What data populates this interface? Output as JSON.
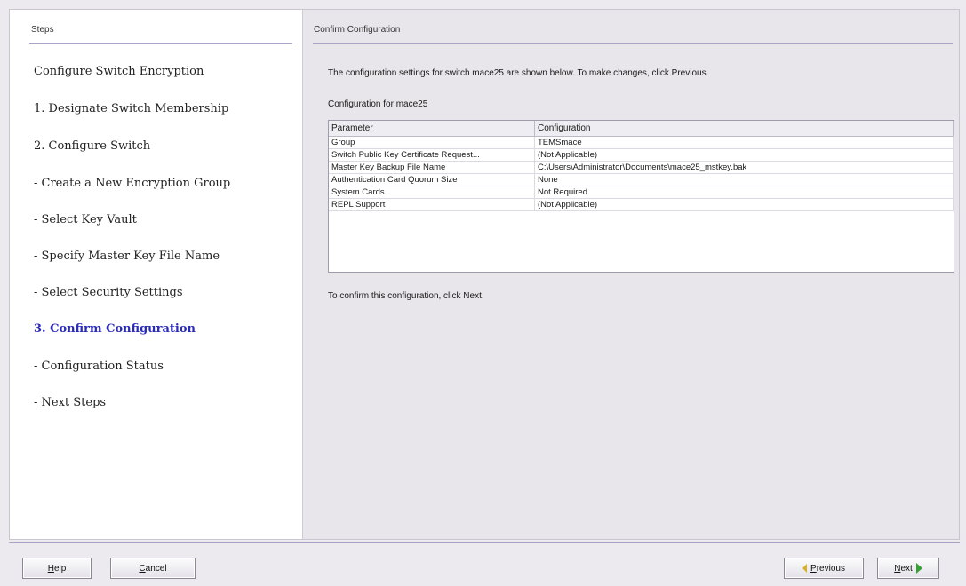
{
  "steps_panel": {
    "header": "Steps",
    "items": [
      {
        "label": "Configure Switch Encryption",
        "active": false
      },
      {
        "label": "1. Designate Switch Membership",
        "active": false
      },
      {
        "label": "2. Configure Switch",
        "active": false
      },
      {
        "label": "- Create a New Encryption Group",
        "active": false
      },
      {
        "label": "- Select Key Vault",
        "active": false
      },
      {
        "label": "- Specify Master Key File Name",
        "active": false
      },
      {
        "label": "- Select Security Settings",
        "active": false
      },
      {
        "label": "3. Confirm Configuration",
        "active": true
      },
      {
        "label": "- Configuration Status",
        "active": false
      },
      {
        "label": "- Next Steps",
        "active": false
      }
    ]
  },
  "content": {
    "header": "Confirm Configuration",
    "intro": "The configuration settings for switch mace25 are shown below. To make changes, click Previous.",
    "caption": "Configuration for mace25",
    "table": {
      "columns": [
        "Parameter",
        "Configuration"
      ],
      "rows": [
        [
          "Group",
          "TEMSmace"
        ],
        [
          "Switch Public Key Certificate Request...",
          "(Not Applicable)"
        ],
        [
          "Master Key Backup File Name",
          "C:\\Users\\Administrator\\Documents\\mace25_mstkey.bak"
        ],
        [
          "Authentication Card Quorum Size",
          "None"
        ],
        [
          "System Cards",
          "Not Required"
        ],
        [
          "REPL Support",
          "(Not Applicable)"
        ]
      ]
    },
    "confirm_text": "To confirm this configuration, click Next."
  },
  "buttons": {
    "help": {
      "prefix": "",
      "mnemonic": "H",
      "rest": "elp"
    },
    "cancel": {
      "prefix": "",
      "mnemonic": "C",
      "rest": "ancel"
    },
    "previous": {
      "prefix": "",
      "mnemonic": "P",
      "rest": "revious"
    },
    "next": {
      "prefix": "",
      "mnemonic": "N",
      "rest": "ext"
    }
  },
  "colors": {
    "active_step": "#2a2ab8",
    "rule": "#a9a3c9",
    "previous_arrow": "#d4b12a",
    "next_arrow": "#3aa036"
  },
  "icons": {
    "previous": "arrow-left-icon",
    "next": "arrow-right-icon"
  }
}
